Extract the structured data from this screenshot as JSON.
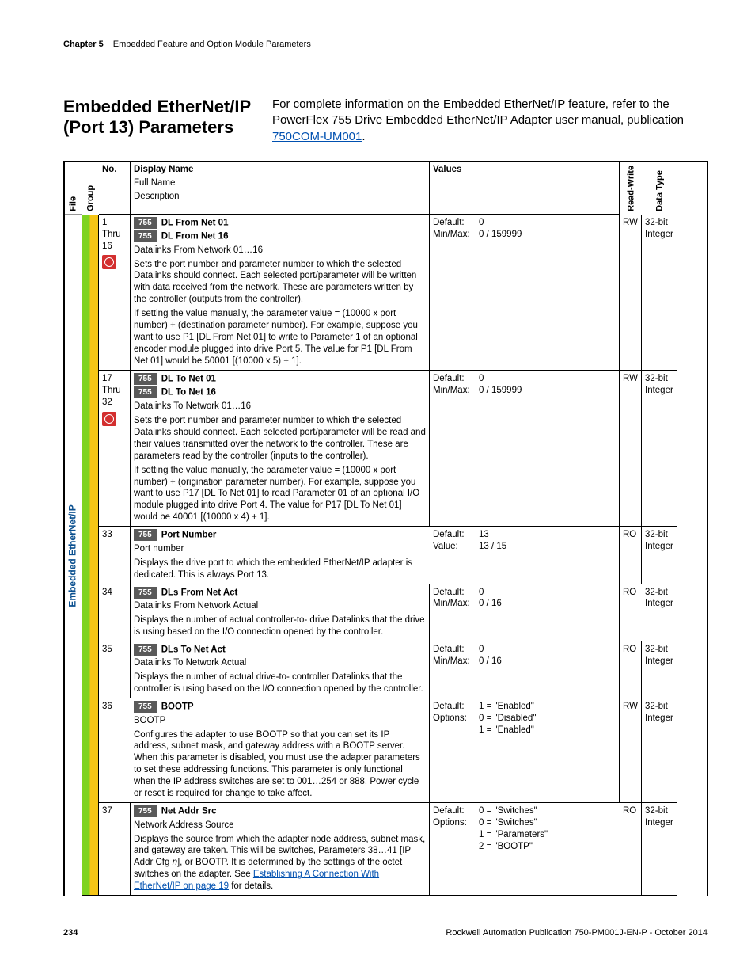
{
  "running_head": {
    "chapter": "Chapter 5",
    "title": "Embedded Feature and Option Module Parameters"
  },
  "section_title": "Embedded EtherNet/IP (Port 13) Parameters",
  "intro": {
    "text_before": "For complete information on the Embedded EtherNet/IP feature, refer to the PowerFlex 755 Drive Embedded EtherNet/IP Adapter user manual, publication ",
    "link_text": "750COM-UM001",
    "text_after": "."
  },
  "headers": {
    "file": "File",
    "group": "Group",
    "no": "No.",
    "display": "Display Name",
    "fullname": "Full Name",
    "description": "Description",
    "values": "Values",
    "rw": "Read-Write",
    "dt": "Data Type"
  },
  "file_label": "Embedded EtherNet/IP",
  "rows": [
    {
      "no_line1": "1",
      "no_line2": "Thru",
      "no_line3": "16",
      "has_stop": true,
      "badge1": "755",
      "disp1": "DL From Net 01",
      "badge2": "755",
      "disp2": "DL From Net 16",
      "fullname": "Datalinks From Network 01…16",
      "desc1": "Sets the port number and parameter number to which the selected Datalinks should connect. Each selected port/parameter will be written with data received from the network. These are parameters written by the controller (outputs from the controller).",
      "desc2": "If setting the value manually, the parameter value = (10000 x port number) + (destination parameter number). For example, suppose you want to use P1 [DL From Net 01] to write to Parameter 1 of an optional encoder module plugged into drive Port 5. The value for P1 [DL From Net 01] would be 50001 [(10000 x 5) + 1].",
      "val_k1": "Default:",
      "val_v1": "0",
      "val_k2": "Min/Max:",
      "val_v2": "0 / 159999",
      "rw": "RW",
      "dt1": "32-bit",
      "dt2": "Integer"
    },
    {
      "no_line1": "17",
      "no_line2": "Thru",
      "no_line3": "32",
      "has_stop": true,
      "badge1": "755",
      "disp1": "DL To Net 01",
      "badge2": "755",
      "disp2": "DL To Net 16",
      "fullname": "Datalinks To Network 01…16",
      "desc1": "Sets the port number and parameter number to which the selected Datalinks should connect. Each selected port/parameter will be read and their values transmitted over the network to the controller. These are parameters read by the controller (inputs to the controller).",
      "desc2": "If setting the value manually, the parameter value = (10000 x port number) + (origination parameter number). For example, suppose you want to use P17 [DL To Net 01] to read Parameter 01 of an optional I/O module plugged into drive Port 4. The value for P17 [DL To Net 01] would be 40001 [(10000 x 4) + 1].",
      "val_k1": "Default:",
      "val_v1": "0",
      "val_k2": "Min/Max:",
      "val_v2": "0 / 159999",
      "rw": "RW",
      "dt1": "32-bit",
      "dt2": "Integer"
    },
    {
      "no_line1": "33",
      "badge1": "755",
      "disp1": "Port Number",
      "fullname": "Port number",
      "desc1": "Displays the drive port to which the embedded EtherNet/IP adapter is dedicated. This is always Port 13.",
      "val_k1": "Default:",
      "val_v1": "13",
      "val_k2": "Value:",
      "val_v2": "13 / 15",
      "rw": "RO",
      "dt1": "32-bit",
      "dt2": "Integer"
    },
    {
      "no_line1": "34",
      "badge1": "755",
      "disp1": "DLs From Net Act",
      "fullname": "Datalinks From Network Actual",
      "desc1": "Displays the number of actual controller-to- drive Datalinks that the drive is using based on the I/O connection opened by the controller.",
      "val_k1": "Default:",
      "val_v1": "0",
      "val_k2": "Min/Max:",
      "val_v2": "0 / 16",
      "rw": "RO",
      "dt1": "32-bit",
      "dt2": "Integer"
    },
    {
      "no_line1": "35",
      "badge1": "755",
      "disp1": "DLs To Net Act",
      "fullname": "Datalinks To Network Actual",
      "desc1": "Displays the number of actual drive-to- controller Datalinks that the controller is using based on the I/O connection opened by the controller.",
      "val_k1": "Default:",
      "val_v1": "0",
      "val_k2": "Min/Max:",
      "val_v2": "0 / 16",
      "rw": "RO",
      "dt1": "32-bit",
      "dt2": "Integer"
    },
    {
      "no_line1": "36",
      "badge1": "755",
      "disp1": "BOOTP",
      "fullname": "BOOTP",
      "desc1": "Configures the adapter to use BOOTP so that you can set its IP address, subnet mask, and gateway address with a BOOTP server. When this parameter is disabled, you must use the adapter parameters to set these addressing functions. This parameter is only functional when the IP address switches are set to 001…254 or 888. Power cycle or reset is required for change to take affect.",
      "val_k1": "Default:",
      "val_v1": "1 = \"Enabled\"",
      "val_k2": "Options:",
      "val_v2": "0 = \"Disabled\"",
      "val_v3": "1 = \"Enabled\"",
      "rw": "RW",
      "dt1": "32-bit",
      "dt2": "Integer"
    },
    {
      "no_line1": "37",
      "badge1": "755",
      "disp1": "Net Addr Src",
      "fullname": "Network Address Source",
      "desc_pre": "Displays the source from which the adapter node address, subnet mask, and gateway are taken. This will be switches, Parameters 38…41 [IP Addr Cfg ",
      "desc_ital": "n",
      "desc_mid": "], or BOOTP. It is determined by the settings of the octet switches on the adapter. See ",
      "desc_link": "Establishing A Connection With EtherNet/IP on page 19",
      "desc_post": " for details.",
      "val_k1": "Default:",
      "val_v1": "0 = \"Switches\"",
      "val_k2": "Options:",
      "val_v2": "0 = \"Switches\"",
      "val_v3": "1 = \"Parameters\"",
      "val_v4": "2 = \"BOOTP\"",
      "rw": "RO",
      "dt1": "32-bit",
      "dt2": "Integer"
    }
  ],
  "footer": {
    "page": "234",
    "pub": "Rockwell Automation Publication 750-PM001J-EN-P - October 2014"
  }
}
